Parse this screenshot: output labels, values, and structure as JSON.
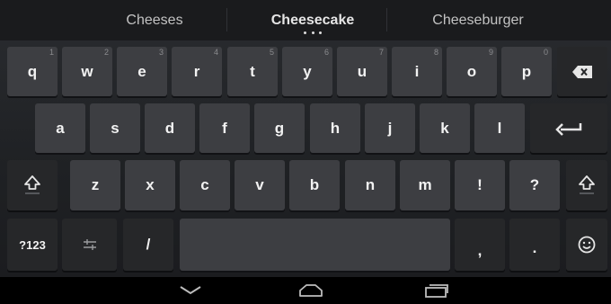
{
  "suggestions": {
    "left": "Cheeses",
    "center": "Cheesecake",
    "right": "Cheeseburger"
  },
  "row1": [
    {
      "label": "q",
      "hint": "1"
    },
    {
      "label": "w",
      "hint": "2"
    },
    {
      "label": "e",
      "hint": "3"
    },
    {
      "label": "r",
      "hint": "4"
    },
    {
      "label": "t",
      "hint": "5"
    },
    {
      "label": "y",
      "hint": "6"
    },
    {
      "label": "u",
      "hint": "7"
    },
    {
      "label": "i",
      "hint": "8"
    },
    {
      "label": "o",
      "hint": "9"
    },
    {
      "label": "p",
      "hint": "0"
    }
  ],
  "row2": [
    {
      "label": "a"
    },
    {
      "label": "s"
    },
    {
      "label": "d"
    },
    {
      "label": "f"
    },
    {
      "label": "g"
    },
    {
      "label": "h"
    },
    {
      "label": "j"
    },
    {
      "label": "k"
    },
    {
      "label": "l"
    }
  ],
  "row3": [
    {
      "label": "z"
    },
    {
      "label": "x"
    },
    {
      "label": "c"
    },
    {
      "label": "v"
    },
    {
      "label": "b"
    },
    {
      "label": "n"
    },
    {
      "label": "m"
    },
    {
      "label": "!"
    },
    {
      "label": "?"
    }
  ],
  "row4": {
    "symbols": "?123",
    "slash": "/",
    "comma": ",",
    "period": "."
  },
  "icons": {
    "backspace": "backspace-icon",
    "enter": "enter-icon",
    "shift": "shift-icon",
    "settings": "settings-sliders-icon",
    "emoji": "emoji-icon",
    "nav_back": "chevron-down-icon",
    "nav_home": "home-icon",
    "nav_recents": "recents-icon"
  },
  "colors": {
    "key": "#3d3e42",
    "function_key": "#262729",
    "background": "#1f2124"
  }
}
